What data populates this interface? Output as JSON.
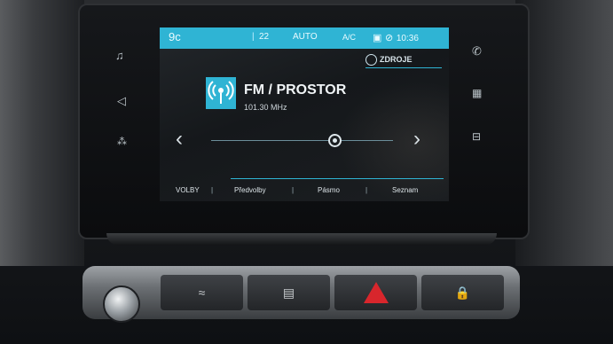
{
  "status_bar": {
    "temp_left": "9c",
    "temp_right": "22",
    "auto_label": "AUTO",
    "ac_label": "A/C",
    "clock": "10:36"
  },
  "sources_button": {
    "label": "ZDROJE"
  },
  "station": {
    "name": "FM / PROSTOR",
    "frequency": "101.30 MHz"
  },
  "tuner": {
    "position_fraction": 0.68
  },
  "tabs": [
    "VOLBY",
    "Předvolby",
    "Pásmo",
    "Seznam"
  ],
  "left_icons": [
    "music-icon",
    "navigation-icon",
    "apps-icon"
  ],
  "right_icons": [
    "phone-icon",
    "apps-grid-icon",
    "car-icon"
  ],
  "colors": {
    "accent": "#2fb4d4"
  }
}
